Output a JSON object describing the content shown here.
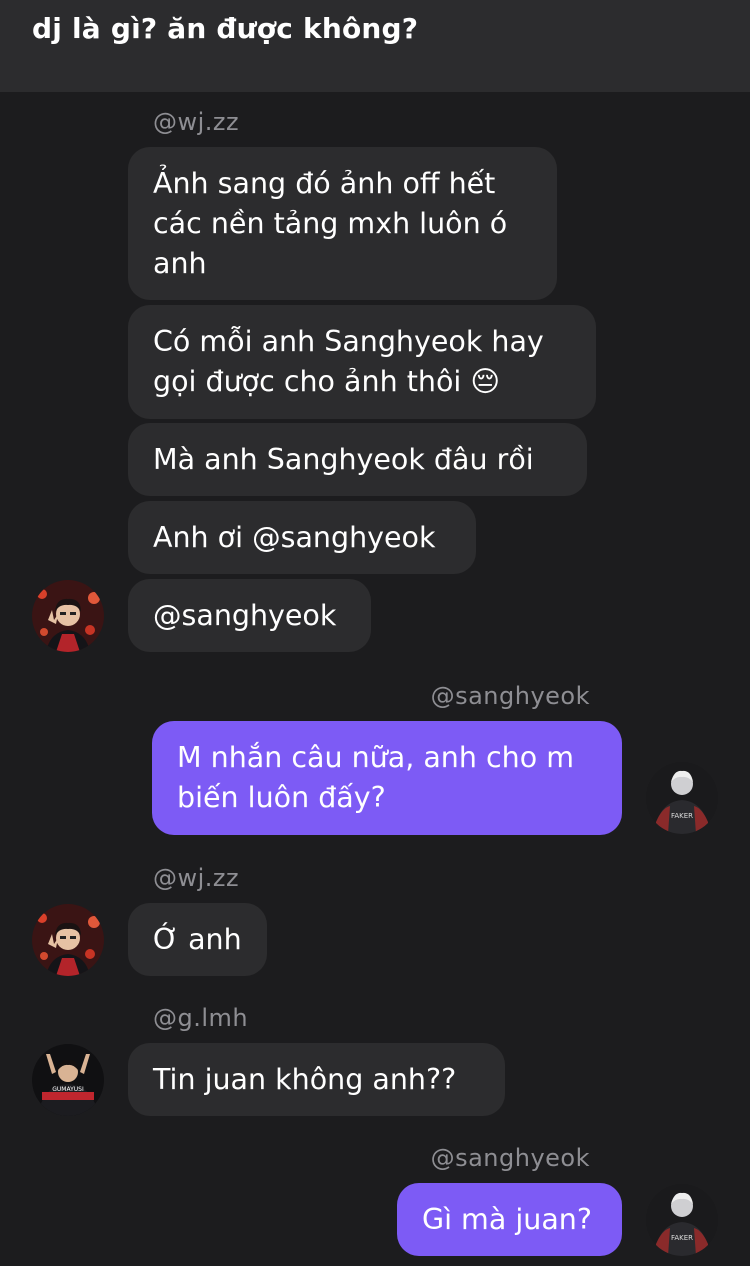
{
  "header": {
    "title": "dj là gì? ăn được không?"
  },
  "messages": [
    {
      "sender": "@wj.zz",
      "bubbles": [
        "Ảnh sang đó ảnh off hết\ncác nền tảng mxh luôn ó\nanh",
        "Có mỗi anh Sanghyeok hay\ngọi được cho ảnh thôi 😔",
        "Mà anh Sanghyeok đâu rồi",
        "Anh ơi @sanghyeok",
        "@sanghyeok"
      ]
    },
    {
      "sender": "@sanghyeok",
      "bubbles": [
        "M nhắn câu nữa, anh cho m\nbiến luôn đấy?"
      ]
    },
    {
      "sender": "@wj.zz",
      "bubbles": [
        "Ớ anh"
      ]
    },
    {
      "sender": "@g.lmh",
      "bubbles": [
        "Tin juan không anh??"
      ]
    },
    {
      "sender": "@sanghyeok",
      "bubbles": [
        "Gì mà juan?"
      ]
    }
  ],
  "avatars": {
    "sanghyeok_jacket_text": "FAKER",
    "glmh_jersey_text": "GUMAYUSI"
  },
  "colors": {
    "background": "#1c1c1e",
    "header_background": "#2c2c2e",
    "incoming_bubble": "#2c2c2e",
    "outgoing_bubble": "#7d5bf5",
    "sender_text": "#8e8e93"
  }
}
